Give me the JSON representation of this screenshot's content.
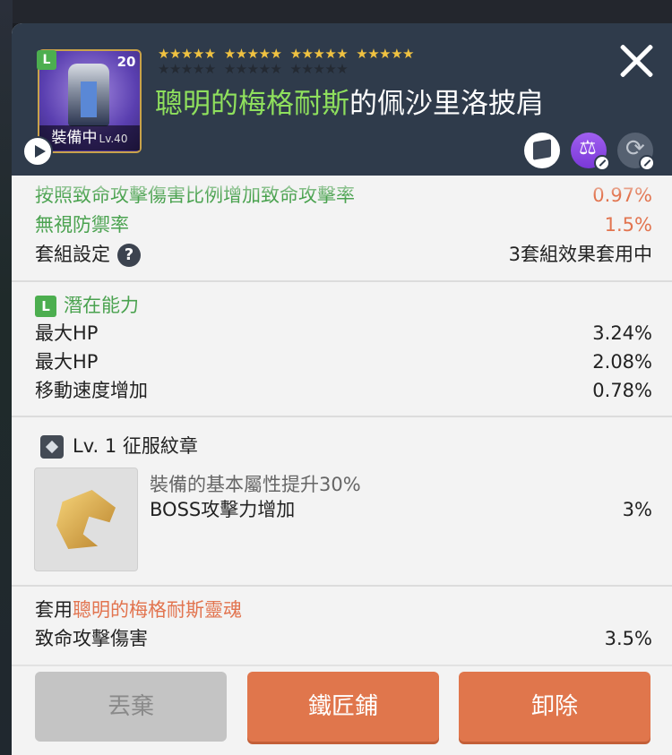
{
  "header": {
    "badge_grade": "L",
    "badge_level": "20",
    "equipped_label": "裝備中",
    "equipped_level": "Lv.40",
    "stars_row1": [
      "★★★★★",
      "★★★★★",
      "★★★★★",
      "★★★★★"
    ],
    "stars_row2": [
      "★★★★★",
      "★★★★★",
      "★★★★★"
    ],
    "title_highlight": "聰明的梅格耐斯",
    "title_rest": "的佩沙里洛披肩",
    "icons": [
      "share-box-icon",
      "balance-icon",
      "cycle-icon"
    ]
  },
  "stats_top": {
    "cutoff_label": "按照致命攻擊傷害比例增加致命攻擊率",
    "cutoff_value": "0.97%",
    "ignore_def_label": "無視防禦率",
    "ignore_def_value": "1.5%",
    "set_label": "套組設定",
    "set_value": "3套組效果套用中"
  },
  "potential": {
    "badge": "L",
    "title": "潛在能力",
    "rows": [
      {
        "label": "最大HP",
        "value": "3.24%"
      },
      {
        "label": "最大HP",
        "value": "2.08%"
      },
      {
        "label": "移動速度增加",
        "value": "0.78%"
      }
    ]
  },
  "emblem": {
    "title": "Lv. 1 征服紋章",
    "desc": "裝備的基本屬性提升30%",
    "stat_label": "BOSS攻擊力增加",
    "stat_value": "3%"
  },
  "soul": {
    "prefix": "套用",
    "name": "聰明的梅格耐斯靈魂",
    "stat_label": "致命攻擊傷害",
    "stat_value": "3.5%"
  },
  "buttons": {
    "discard": "丟棄",
    "smith": "鐵匠鋪",
    "unequip": "卸除"
  },
  "colors": {
    "accent_orange": "#e0764c",
    "grade_green": "#4cae4f",
    "header_bg": "#2f3b4b"
  }
}
